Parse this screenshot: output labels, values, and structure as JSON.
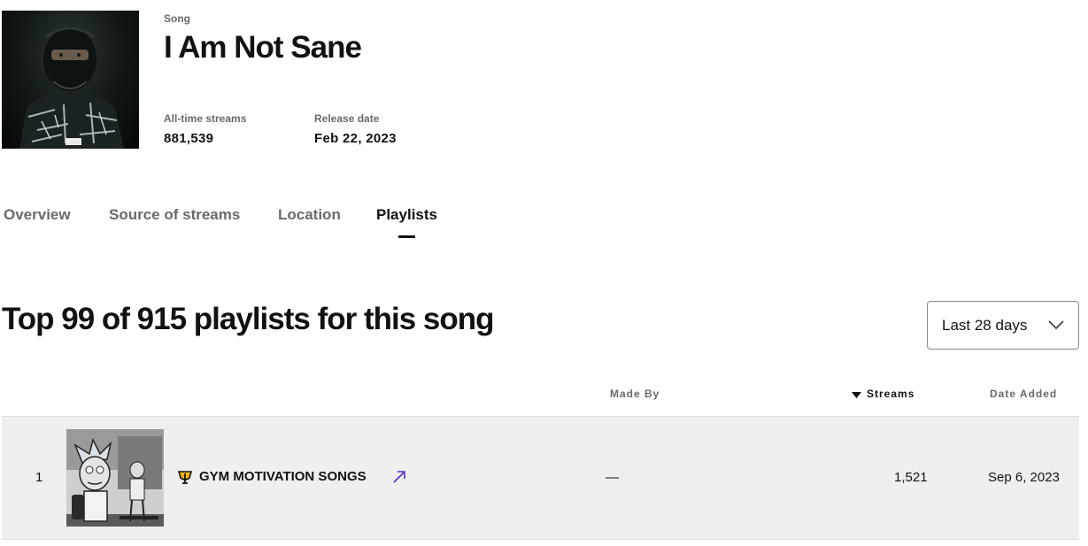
{
  "song": {
    "label": "Song",
    "title": "I Am Not Sane",
    "stats": [
      {
        "label": "All-time streams",
        "value": "881,539"
      },
      {
        "label": "Release date",
        "value": "Feb 22, 2023"
      }
    ]
  },
  "tabs": [
    {
      "label": "Overview"
    },
    {
      "label": "Source of streams"
    },
    {
      "label": "Location"
    },
    {
      "label": "Playlists",
      "active": true
    }
  ],
  "section": {
    "title": "Top 99 of 915 playlists for this song",
    "range": "Last 28 days"
  },
  "table": {
    "columns": {
      "made_by": "Made By",
      "streams": "Streams",
      "date_added": "Date Added"
    },
    "rows": [
      {
        "rank": "1",
        "name": "GYM MOTIVATION SONGS",
        "made_by": "—",
        "streams": "1,521",
        "date_added": "Sep 6, 2023"
      }
    ]
  },
  "colors": {
    "accent_link": "#5b2bd6",
    "badge": "#f5b800"
  },
  "icons": {
    "external": "arrow-up-right-icon",
    "playlist_badge": "trophy-badge-icon",
    "range": "chevron-down-icon"
  }
}
